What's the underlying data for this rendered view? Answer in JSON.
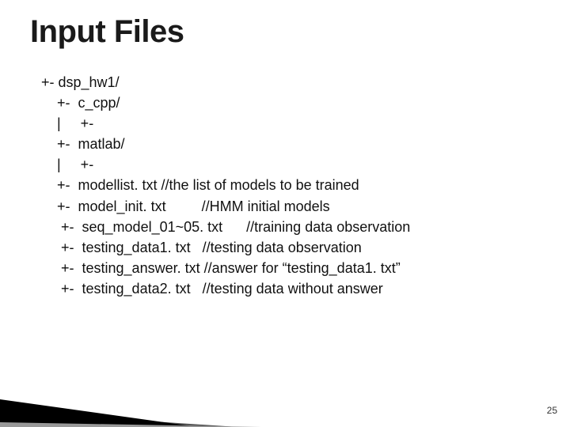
{
  "title": "Input Files",
  "lines": [
    {
      "prefix": "+- ",
      "file": "dsp_hw1/",
      "comment": ""
    },
    {
      "prefix": "    +-  ",
      "file": "c_cpp/",
      "comment": ""
    },
    {
      "prefix": "    |     +-",
      "file": "",
      "comment": ""
    },
    {
      "prefix": "    +-  ",
      "file": "matlab/",
      "comment": ""
    },
    {
      "prefix": "    |     +-",
      "file": "",
      "comment": ""
    },
    {
      "prefix": "    +-  ",
      "file": "modellist. txt ",
      "comment": "//the list of models to be trained"
    },
    {
      "prefix": "    +-  ",
      "file": "model_init. txt         ",
      "comment": "//HMM initial models"
    },
    {
      "prefix": "     +-  ",
      "file": "seq_model_01~05. txt      ",
      "comment": "//training data observation"
    },
    {
      "prefix": "     +-  ",
      "file": "testing_data1. txt   ",
      "comment": "//testing data observation"
    },
    {
      "prefix": "     +-  ",
      "file": "testing_answer. txt ",
      "comment": "//answer for “testing_data1. txt”"
    },
    {
      "prefix": "     +-  ",
      "file": "testing_data2. txt   ",
      "comment": "//testing data without answer"
    }
  ],
  "page_number": "25"
}
